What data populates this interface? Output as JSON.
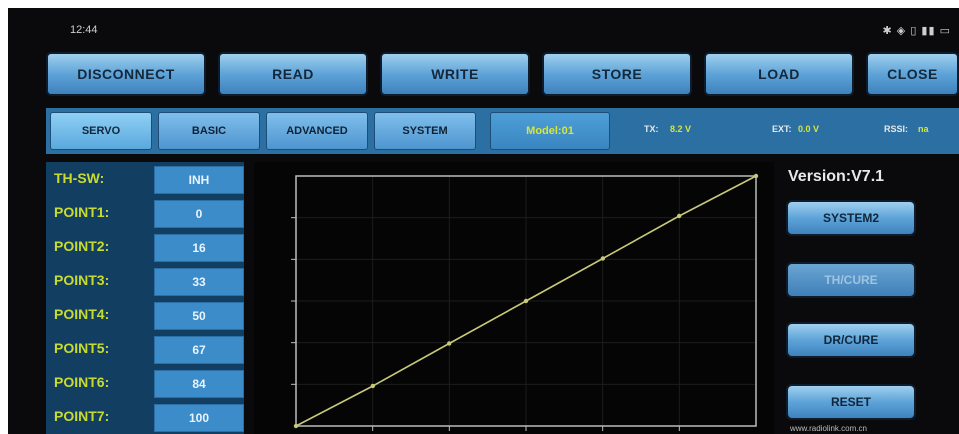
{
  "status": {
    "time": "12:44",
    "icons": "✱ ◈ ▯ ▮▮ ▭"
  },
  "toolbar": {
    "disconnect_label": "DISCONNECT",
    "read_label": "READ",
    "write_label": "WRITE",
    "store_label": "STORE",
    "load_label": "LOAD",
    "close_label": "CLOSE"
  },
  "tabs": {
    "servo": "SERVO",
    "basic": "BASIC",
    "advanced": "ADVANCED",
    "system": "SYSTEM",
    "model": "Model:01"
  },
  "readouts": {
    "tx_label": "TX:",
    "tx_value": "8.2 V",
    "ext_label": "EXT:",
    "ext_value": "0.0 V",
    "rssi_label": "RSSI:",
    "rssi_value": "na"
  },
  "points": [
    {
      "label": "TH-SW:",
      "value": "INH"
    },
    {
      "label": "POINT1:",
      "value": "0"
    },
    {
      "label": "POINT2:",
      "value": "16"
    },
    {
      "label": "POINT3:",
      "value": "33"
    },
    {
      "label": "POINT4:",
      "value": "50"
    },
    {
      "label": "POINT5:",
      "value": "67"
    },
    {
      "label": "POINT6:",
      "value": "84"
    },
    {
      "label": "POINT7:",
      "value": "100"
    }
  ],
  "right": {
    "version": "Version:V7.1",
    "system2_label": "SYSTEM2",
    "thcurve_label": "TH/CURE",
    "drcurve_label": "DR/CURE",
    "reset_label": "RESET",
    "url": "www.radiolink.com.cn"
  },
  "curve": {
    "x": [
      0,
      16.7,
      33.3,
      50,
      66.7,
      83.3,
      100
    ],
    "y": [
      0,
      16,
      33,
      50,
      67,
      84,
      100
    ],
    "xlim": [
      0,
      100
    ],
    "ylim": [
      0,
      100
    ]
  },
  "colors": {
    "accent": "#3b8cc8",
    "label": "#c9dc2e",
    "curve": "#c8c87a",
    "tab_bar": "#2b6fa3"
  }
}
